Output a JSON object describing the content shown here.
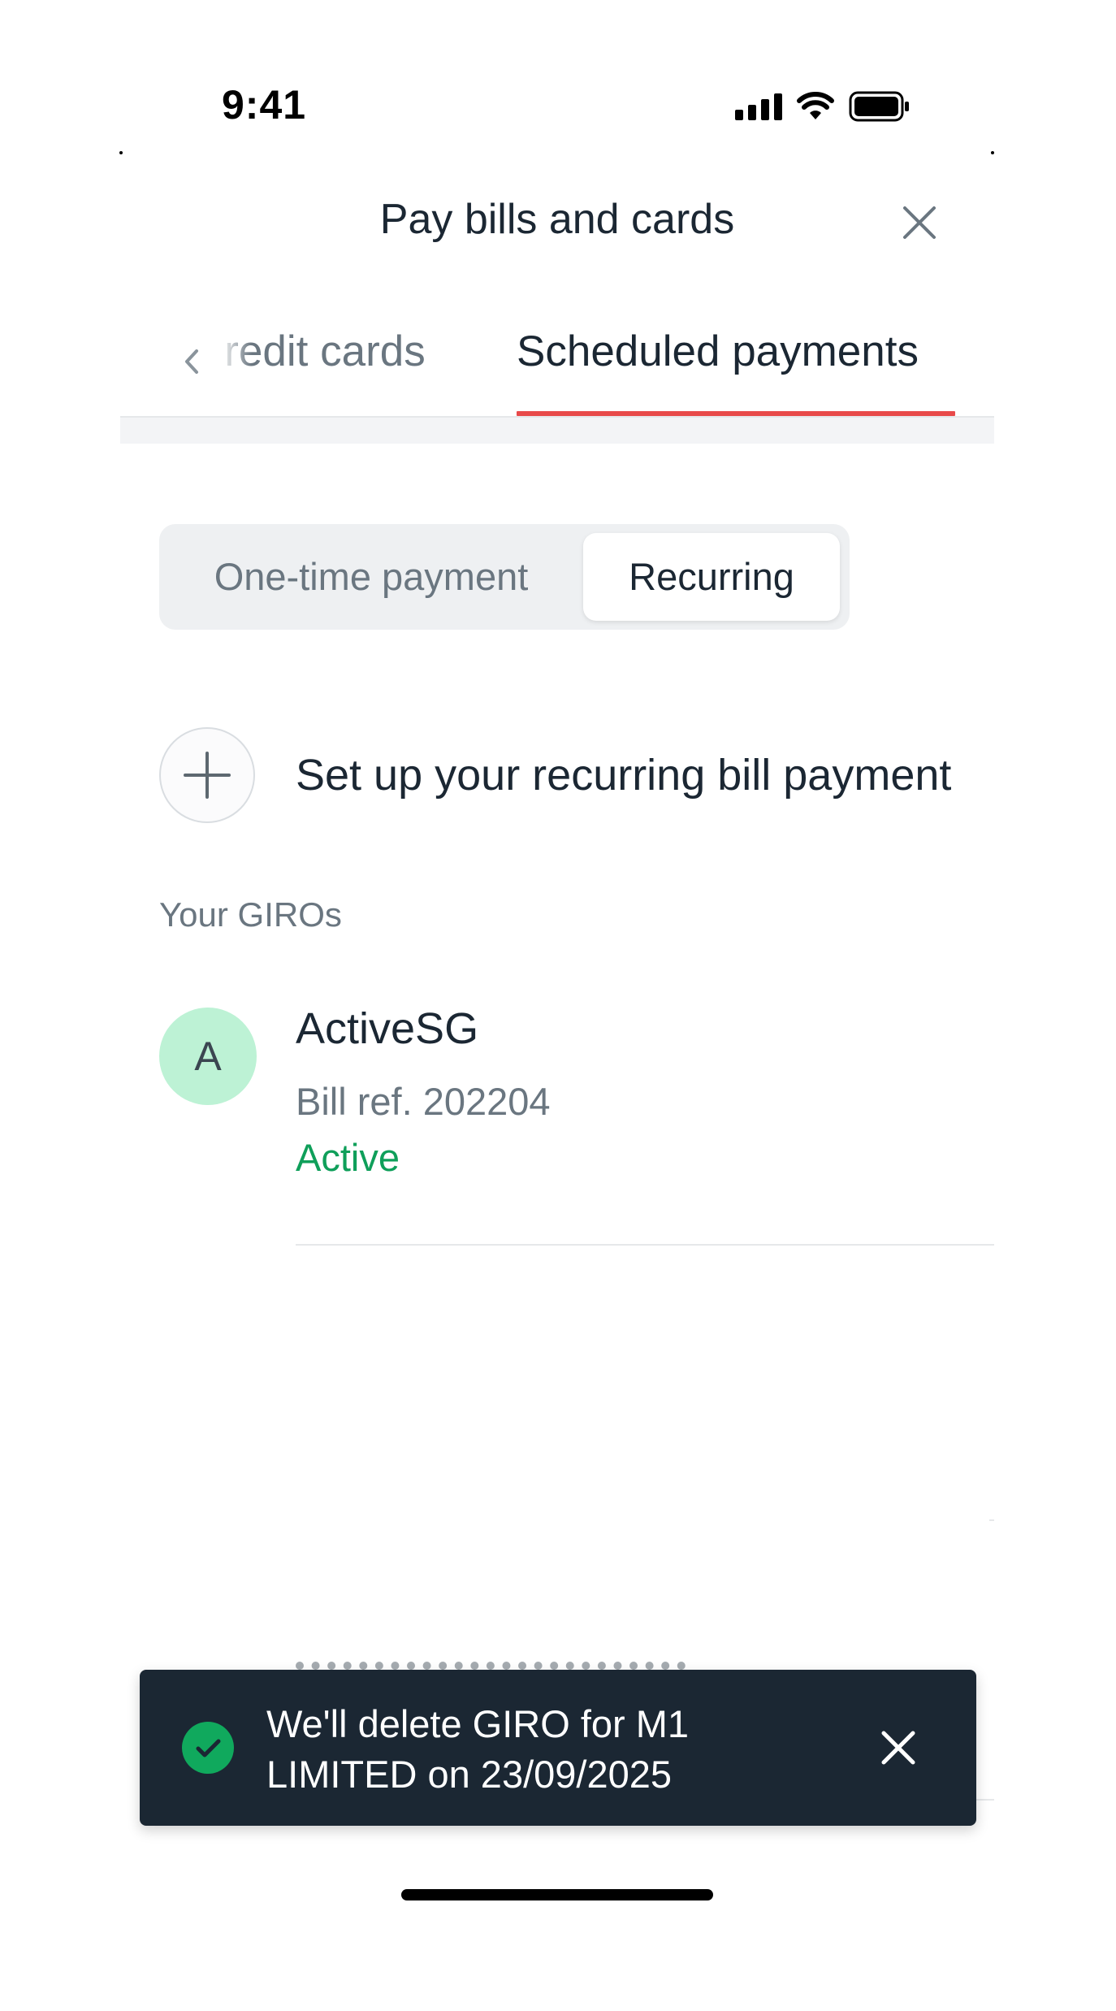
{
  "status_bar": {
    "time": "9:41"
  },
  "header": {
    "title": "Pay bills and cards"
  },
  "tabs": {
    "previous_label": "Credit cards",
    "active_label": "Scheduled payments"
  },
  "segmented": {
    "option_one_time": "One-time payment",
    "option_recurring": "Recurring",
    "selected": "Recurring"
  },
  "setup": {
    "label": "Set up your recurring bill payment"
  },
  "giros": {
    "section_title": "Your GIROs",
    "items": [
      {
        "avatar_letter": "A",
        "name": "ActiveSG",
        "ref": "Bill ref. 202204",
        "status": "Active"
      }
    ]
  },
  "toast": {
    "message_line1": "We'll delete GIRO for M1",
    "message_line2": "LIMITED on 23/09/2025"
  },
  "colors": {
    "accent_red": "#e84a4a",
    "active_green": "#0f9f5a",
    "toast_bg": "#1b2733",
    "avatar_bg": "#bdf2d5"
  },
  "icons": [
    "cellular-signal-icon",
    "wifi-icon",
    "battery-icon",
    "close-icon",
    "chevron-left-icon",
    "plus-icon",
    "check-circle-icon"
  ]
}
